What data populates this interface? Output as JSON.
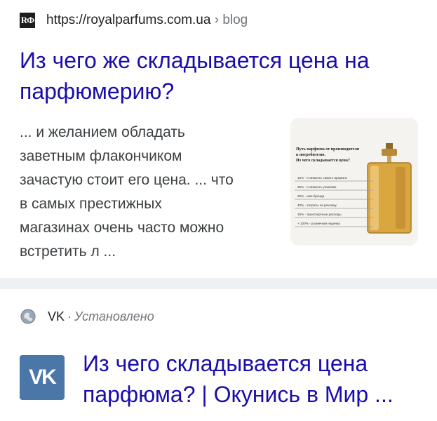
{
  "result1": {
    "favicon_text": "RФ",
    "url": "https://royalparfums.com.ua",
    "breadcrumb": " › blog",
    "title": "Из чего же складывается цена на парфюмерию?",
    "snippet_lines": [
      "... и желанием обладать",
      "заветным флакончиком",
      "зачастую стоит его цена. ... что",
      "в самых престижных",
      "магазинах очень часто можно",
      "встретить л ..."
    ],
    "thumbnail": {
      "heading_lines": [
        "Путь парфюма от производителя",
        "к потребителю.",
        "Из чего складывается цена?"
      ],
      "rows": [
        "15% - стоимость самого аромата",
        "25% - стоимость упаковки",
        "25% - имя бренда",
        "40% - затраты на рекламу",
        "15% - транспортные расходы",
        "+ 100% - розничная наценка"
      ]
    }
  },
  "result2": {
    "source": "VK",
    "separator": "·",
    "status": "Установлено",
    "logo_text": "VK",
    "title": "Из чего складывается цена парфюма? | Окунись в Мир ..."
  },
  "colors": {
    "link": "#1a0dab",
    "vk_brand": "#4a76a8",
    "divider": "#eef1f4",
    "perfume": "#d9a63f"
  }
}
